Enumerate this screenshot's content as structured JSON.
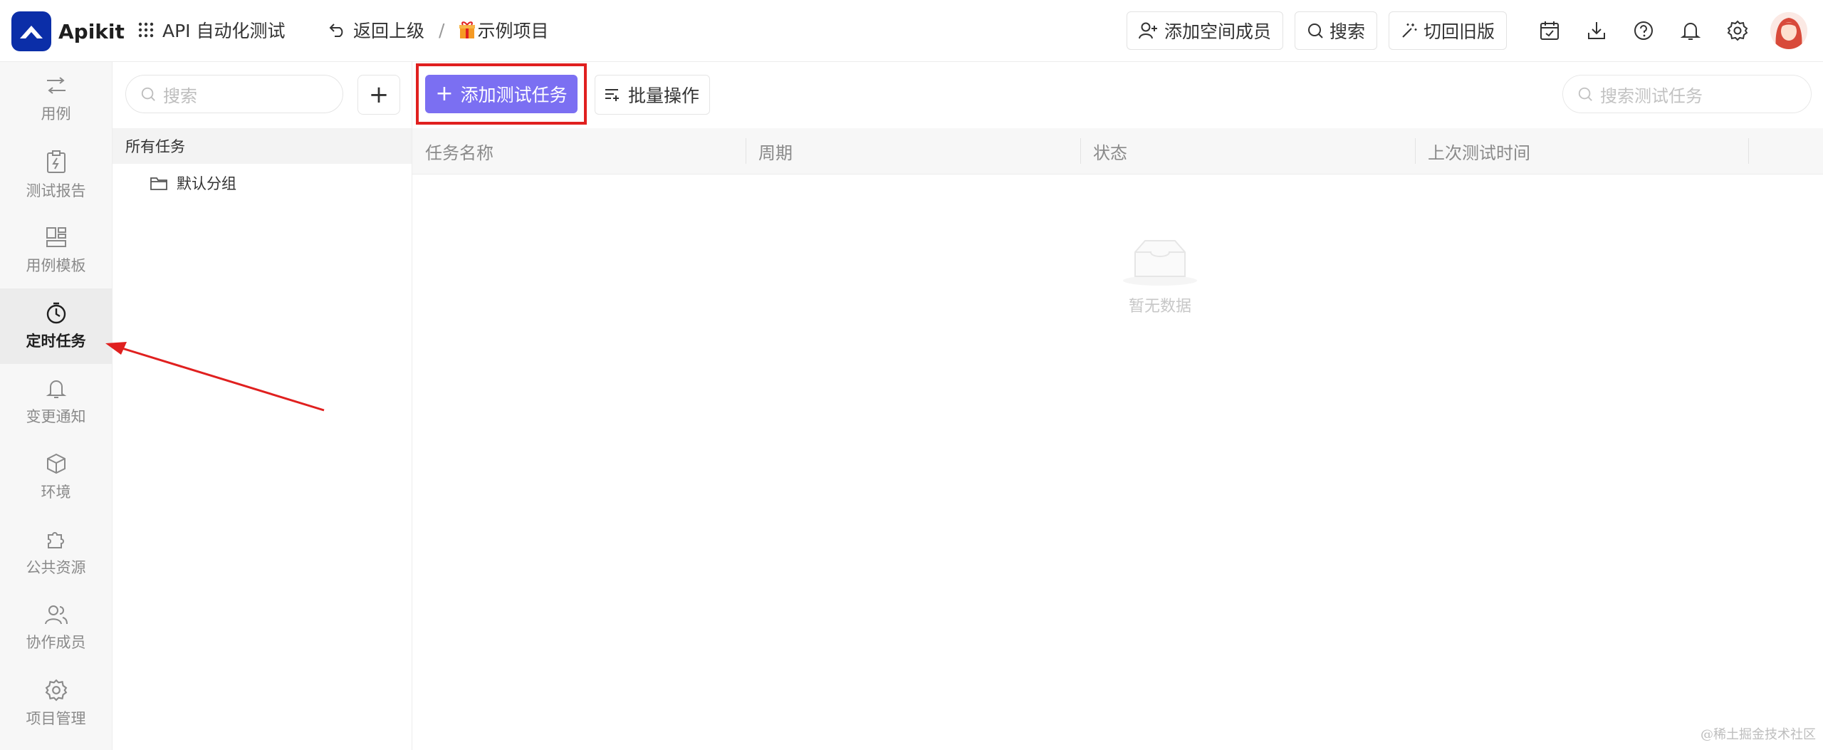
{
  "colors": {
    "brand": "#0b2ea8",
    "accent": "#7b6ff2",
    "highlight": "#e0201f"
  },
  "header": {
    "logo_text": "Apikit",
    "app_name": "API 自动化测试",
    "back_label": "返回上级",
    "breadcrumb_sep": "/",
    "project_name": "示例项目",
    "add_member_label": "添加空间成员",
    "search_label": "搜索",
    "old_version_label": "切回旧版",
    "icons": [
      "calendar-check-icon",
      "download-icon",
      "help-icon",
      "bell-icon",
      "gear-icon"
    ]
  },
  "sidebar": {
    "items": [
      {
        "label": "用例",
        "icon": "flow-icon"
      },
      {
        "label": "测试报告",
        "icon": "report-icon"
      },
      {
        "label": "用例模板",
        "icon": "template-icon"
      },
      {
        "label": "定时任务",
        "icon": "timer-icon",
        "active": true
      },
      {
        "label": "变更通知",
        "icon": "bell-icon"
      },
      {
        "label": "环境",
        "icon": "cube-icon"
      },
      {
        "label": "公共资源",
        "icon": "puzzle-icon"
      },
      {
        "label": "协作成员",
        "icon": "users-icon"
      },
      {
        "label": "项目管理",
        "icon": "gear-icon"
      }
    ]
  },
  "tree": {
    "search_placeholder": "搜索",
    "add_label": "+",
    "all_tasks_label": "所有任务",
    "groups": [
      "默认分组"
    ]
  },
  "toolbar": {
    "add_task_label": "添加测试任务",
    "batch_label": "批量操作",
    "search_placeholder": "搜索测试任务"
  },
  "table": {
    "columns": [
      "任务名称",
      "周期",
      "状态",
      "上次测试时间"
    ],
    "rows": [],
    "empty_text": "暂无数据"
  },
  "watermark": "@稀土掘金技术社区"
}
